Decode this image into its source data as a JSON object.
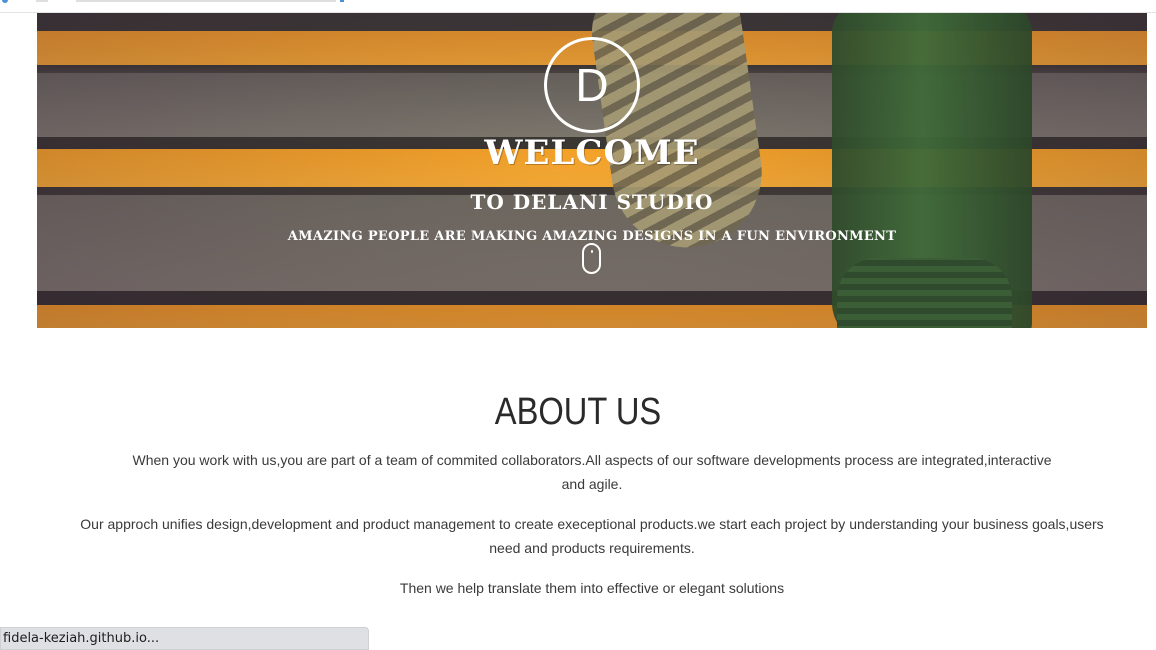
{
  "hero": {
    "logo_letter": "D",
    "welcome": "WELCOME",
    "studio": "TO DELANI STUDIO",
    "tagline": "AMAZING PEOPLE ARE MAKING AMAZING DESIGNS IN A FUN ENVIRONMENT",
    "scroll_icon": "mouse-icon"
  },
  "about": {
    "title": "ABOUT US",
    "paragraphs": [
      "When you work with us,you are part of a team of commited collaborators.All aspects of our software developments process are integrated,interactive and agile.",
      "Our approch unifies design,development and product management to create execeptional products.we start each project by understanding your business goals,users need and products requirements.",
      "Then we help translate them into effective or elegant solutions"
    ]
  },
  "status_bar": {
    "url": "fidela-keziah.github.io..."
  },
  "colors": {
    "accent_orange": "#f0a534",
    "hero_dark": "#3e3b36",
    "text_dark": "#2a2a2a"
  }
}
